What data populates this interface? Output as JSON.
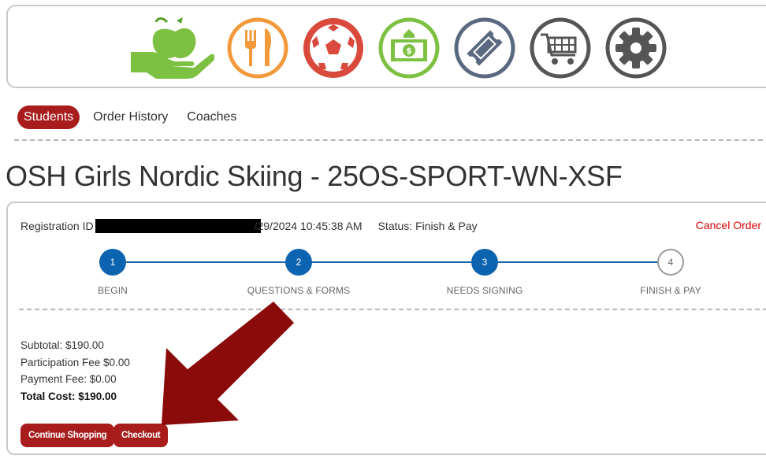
{
  "categories": [
    {
      "name": "food-donation",
      "icon": "hand-apple-icon",
      "color": "#7cc142"
    },
    {
      "name": "meals",
      "icon": "fork-knife-icon",
      "color": "#f29a3b"
    },
    {
      "name": "sports",
      "icon": "soccer-ball-icon",
      "color": "#d94a3d"
    },
    {
      "name": "fees",
      "icon": "money-bill-icon",
      "color": "#7cc142"
    },
    {
      "name": "tickets",
      "icon": "ticket-icon",
      "color": "#5a6880"
    },
    {
      "name": "store",
      "icon": "shopping-cart-icon",
      "color": "#555555"
    },
    {
      "name": "settings",
      "icon": "gear-icon",
      "color": "#555555"
    }
  ],
  "nav": {
    "tabs": [
      "Students",
      "Order History",
      "Coaches"
    ],
    "active": "Students"
  },
  "page": {
    "title": "OSH Girls Nordic Skiing - 25OS-SPORT-WN-XSF"
  },
  "order": {
    "registration_label": "Registration ID",
    "date_fragment": "/29/2024 10:45:38 AM",
    "status": "Status: Finish & Pay",
    "cancel_label": "Cancel Order"
  },
  "steps": [
    {
      "number": "1",
      "label": "BEGIN",
      "state": "complete"
    },
    {
      "number": "2",
      "label": "QUESTIONS & FORMS",
      "state": "complete"
    },
    {
      "number": "3",
      "label": "NEEDS SIGNING",
      "state": "complete"
    },
    {
      "number": "4",
      "label": "FINISH & PAY",
      "state": "pending"
    }
  ],
  "totals": {
    "subtotal": "Subtotal: $190.00",
    "participation_fee": "Participation Fee $0.00",
    "payment_fee": "Payment Fee: $0.00",
    "total_cost": "Total Cost: $190.00"
  },
  "buttons": {
    "continue_label": "Continue Shopping",
    "checkout_label": "Checkout"
  },
  "colors": {
    "brand_red": "#a81c1c",
    "step_blue": "#0c63b0",
    "cancel_red": "#e00000",
    "annotation_arrow": "#8b0a0a"
  }
}
